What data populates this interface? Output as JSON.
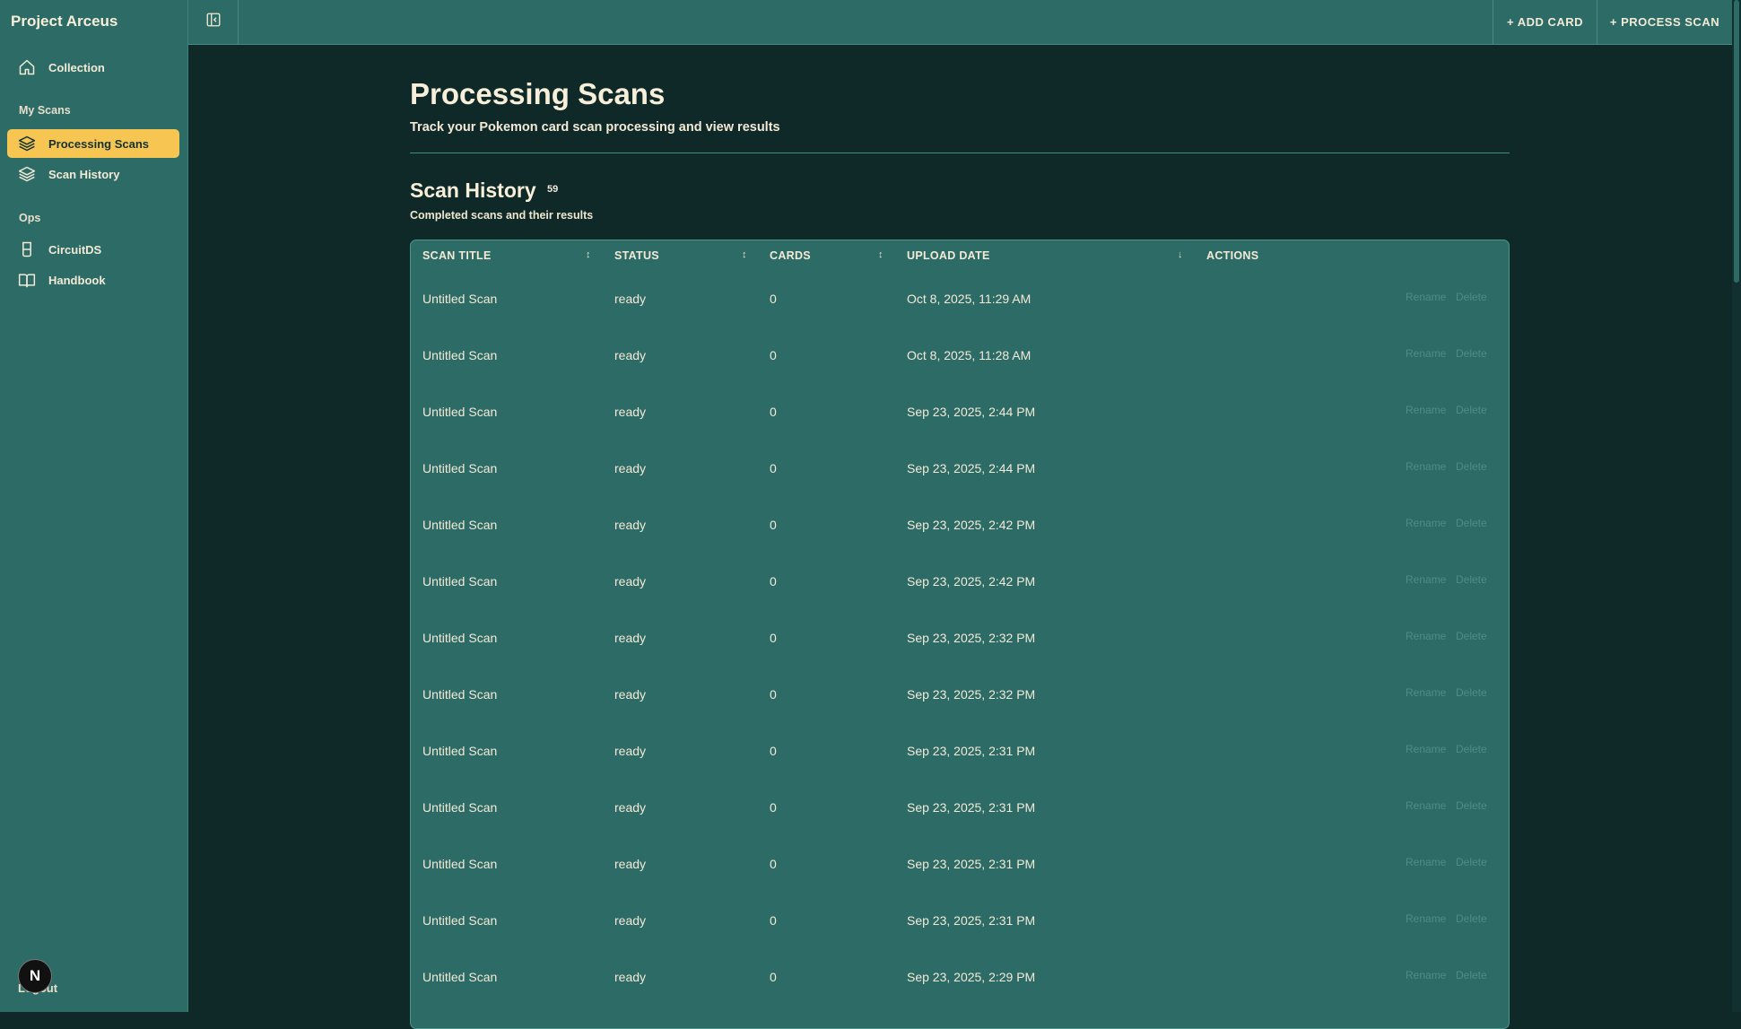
{
  "app": {
    "title": "Project Arceus"
  },
  "sidebar": {
    "items": [
      {
        "label": "Collection"
      },
      {
        "label": "Processing Scans"
      },
      {
        "label": "Scan History"
      },
      {
        "label": "CircuitDS"
      },
      {
        "label": "Handbook"
      }
    ],
    "sections": {
      "my_scans": "My Scans",
      "ops": "Ops"
    },
    "avatar_letter": "N",
    "logout": "Logout"
  },
  "topbar": {
    "add_card": "+ ADD CARD",
    "process_scan": "+ PROCESS SCAN"
  },
  "page": {
    "title": "Processing Scans",
    "subtitle": "Track your Pokemon card scan processing and view results"
  },
  "scan_history": {
    "title": "Scan History",
    "count": "59",
    "subtitle": "Completed scans and their results",
    "columns": [
      "SCAN TITLE",
      "STATUS",
      "CARDS",
      "UPLOAD DATE",
      "ACTIONS"
    ],
    "sort_icons": {
      "unsorted": "↕",
      "sorted_desc": "↓"
    },
    "action_labels": {
      "rename": "Rename",
      "delete": "Delete"
    },
    "rows": [
      {
        "title": "Untitled Scan",
        "status": "ready",
        "cards": "0",
        "date": "Oct 8, 2025, 11:29 AM"
      },
      {
        "title": "Untitled Scan",
        "status": "ready",
        "cards": "0",
        "date": "Oct 8, 2025, 11:28 AM"
      },
      {
        "title": "Untitled Scan",
        "status": "ready",
        "cards": "0",
        "date": "Sep 23, 2025, 2:44 PM"
      },
      {
        "title": "Untitled Scan",
        "status": "ready",
        "cards": "0",
        "date": "Sep 23, 2025, 2:44 PM"
      },
      {
        "title": "Untitled Scan",
        "status": "ready",
        "cards": "0",
        "date": "Sep 23, 2025, 2:42 PM"
      },
      {
        "title": "Untitled Scan",
        "status": "ready",
        "cards": "0",
        "date": "Sep 23, 2025, 2:42 PM"
      },
      {
        "title": "Untitled Scan",
        "status": "ready",
        "cards": "0",
        "date": "Sep 23, 2025, 2:32 PM"
      },
      {
        "title": "Untitled Scan",
        "status": "ready",
        "cards": "0",
        "date": "Sep 23, 2025, 2:32 PM"
      },
      {
        "title": "Untitled Scan",
        "status": "ready",
        "cards": "0",
        "date": "Sep 23, 2025, 2:31 PM"
      },
      {
        "title": "Untitled Scan",
        "status": "ready",
        "cards": "0",
        "date": "Sep 23, 2025, 2:31 PM"
      },
      {
        "title": "Untitled Scan",
        "status": "ready",
        "cards": "0",
        "date": "Sep 23, 2025, 2:31 PM"
      },
      {
        "title": "Untitled Scan",
        "status": "ready",
        "cards": "0",
        "date": "Sep 23, 2025, 2:31 PM"
      },
      {
        "title": "Untitled Scan",
        "status": "ready",
        "cards": "0",
        "date": "Sep 23, 2025, 2:29 PM"
      }
    ]
  },
  "colors": {
    "accent": "#f6c552",
    "panel": "#2d6b67",
    "background": "#0f2928"
  },
  "icons": {
    "collapse": "sidebar-collapse-icon",
    "collection": "home-icon",
    "processing": "layers-icon",
    "history": "layers-icon",
    "circuitds": "flask-icon",
    "handbook": "book-icon"
  }
}
